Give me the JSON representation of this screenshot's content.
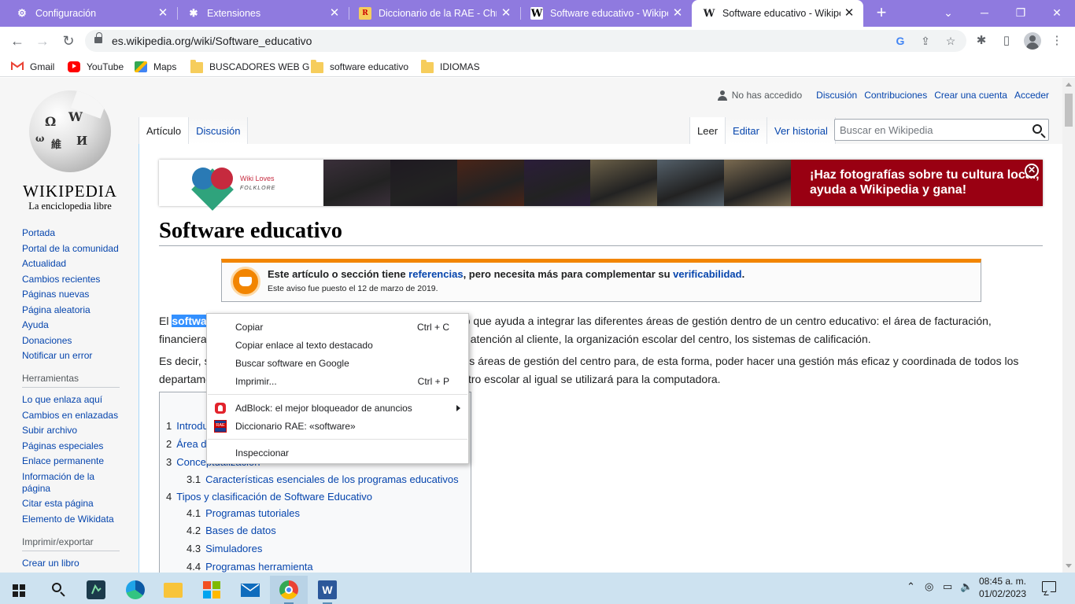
{
  "browser": {
    "tabs": [
      {
        "label": "Configuración",
        "icon": "gear-icon",
        "active": false
      },
      {
        "label": "Extensiones",
        "icon": "puzzle-icon",
        "active": false
      },
      {
        "label": "Diccionario de la RAE - Chrom",
        "icon": "rae-icon",
        "active": false
      },
      {
        "label": "Software educativo - Wikipedi",
        "icon": "wikipedia-icon",
        "active": false
      },
      {
        "label": "Software educativo - Wikipedi",
        "icon": "wikipedia-icon",
        "active": true
      }
    ],
    "url": "es.wikipedia.org/wiki/Software_educativo",
    "bookmarks": [
      {
        "label": "Gmail",
        "icon": "gmail-icon"
      },
      {
        "label": "YouTube",
        "icon": "youtube-icon"
      },
      {
        "label": "Maps",
        "icon": "maps-icon"
      },
      {
        "label": "BUSCADORES WEB G",
        "icon": "folder-icon"
      },
      {
        "label": "software educativo",
        "icon": "folder-icon"
      },
      {
        "label": "IDIOMAS",
        "icon": "folder-icon"
      }
    ]
  },
  "wiki": {
    "logo": {
      "wordmark": "WIKIPEDIA",
      "tagline": "La enciclopedia libre"
    },
    "userbar": {
      "status": "No has accedido",
      "links": [
        "Discusión",
        "Contribuciones",
        "Crear una cuenta",
        "Acceder"
      ]
    },
    "tabs_left": [
      "Artículo",
      "Discusión"
    ],
    "tabs_right": [
      "Leer",
      "Editar",
      "Ver historial"
    ],
    "search_placeholder": "Buscar en Wikipedia",
    "sidebar": {
      "main": [
        "Portada",
        "Portal de la comunidad",
        "Actualidad",
        "Cambios recientes",
        "Páginas nuevas",
        "Página aleatoria",
        "Ayuda",
        "Donaciones",
        "Notificar un error"
      ],
      "tools_heading": "Herramientas",
      "tools": [
        "Lo que enlaza aquí",
        "Cambios en enlazadas",
        "Subir archivo",
        "Páginas especiales",
        "Enlace permanente",
        "Información de la página",
        "Citar esta página",
        "Elemento de Wikidata"
      ],
      "print_heading": "Imprimir/exportar",
      "print": [
        "Crear un libro"
      ]
    },
    "banner": {
      "brand_line1": "Wiki Loves",
      "brand_line2": "FOLKLORE",
      "message": "¡Haz fotografías sobre tu cultura local, ayuda a Wikipedia y gana!",
      "photo_colors": [
        "#3a2f3a",
        "#1f1a22",
        "#4a2418",
        "#2b1d3a",
        "#6b6048",
        "#54606a",
        "#7a6a50"
      ]
    },
    "title": "Software educativo",
    "notice": {
      "text_pre": "Este artículo o sección tiene ",
      "link1": "referencias",
      "text_mid": ", pero necesita más para complementar su ",
      "link2": "verificabilidad",
      "text_end": ".",
      "subtext": "Este aviso fue puesto el 12 de marzo de 2019."
    },
    "para1_line1_pre": "El ",
    "para1_selected": "softwa",
    "para1_line1_post": "tico que ayuda a integrar las diferentes áreas de gestión dentro de un centro educativo: el área de facturación,",
    "para1_line2_pre": "financiera",
    "para1_line2_post": "atención al cliente, la organización escolar del centro, los sistemas de calificación.",
    "para2_line1_pre": "Es decir, s",
    "para2_line1_post": "tes áreas de gestión del centro para, de esta forma, poder hacer una gestión más eficaz y coordinada de todos los",
    "para2_line2_pre": "departame",
    "para2_line2_post": "tro escolar al igual se utilizará para la computadora.",
    "toc": [
      {
        "num": "1",
        "label": "Introdu"
      },
      {
        "num": "2",
        "label": "Área d"
      },
      {
        "num": "3",
        "label": "Conceptualización"
      },
      {
        "num": "3.1",
        "label": "Características esenciales de los programas educativos"
      },
      {
        "num": "4",
        "label": "Tipos y clasificación de Software Educativo"
      },
      {
        "num": "4.1",
        "label": "Programas tutoriales"
      },
      {
        "num": "4.2",
        "label": "Bases de datos"
      },
      {
        "num": "4.3",
        "label": "Simuladores"
      },
      {
        "num": "4.4",
        "label": "Programas herramienta"
      }
    ]
  },
  "context_menu": {
    "items": [
      {
        "label": "Copiar",
        "shortcut": "Ctrl + C"
      },
      {
        "label": "Copiar enlace al texto destacado",
        "shortcut": ""
      },
      {
        "label": "Buscar software en Google",
        "shortcut": ""
      },
      {
        "label": "Imprimir...",
        "shortcut": "Ctrl + P"
      },
      {
        "label": "AdBlock: el mejor bloqueador de anuncios",
        "shortcut": ""
      },
      {
        "label": "Diccionario RAE: «software»",
        "shortcut": ""
      },
      {
        "label": "Inspeccionar",
        "shortcut": ""
      }
    ]
  },
  "taskbar": {
    "time": "08:45 a. m.",
    "date": "01/02/2023"
  }
}
